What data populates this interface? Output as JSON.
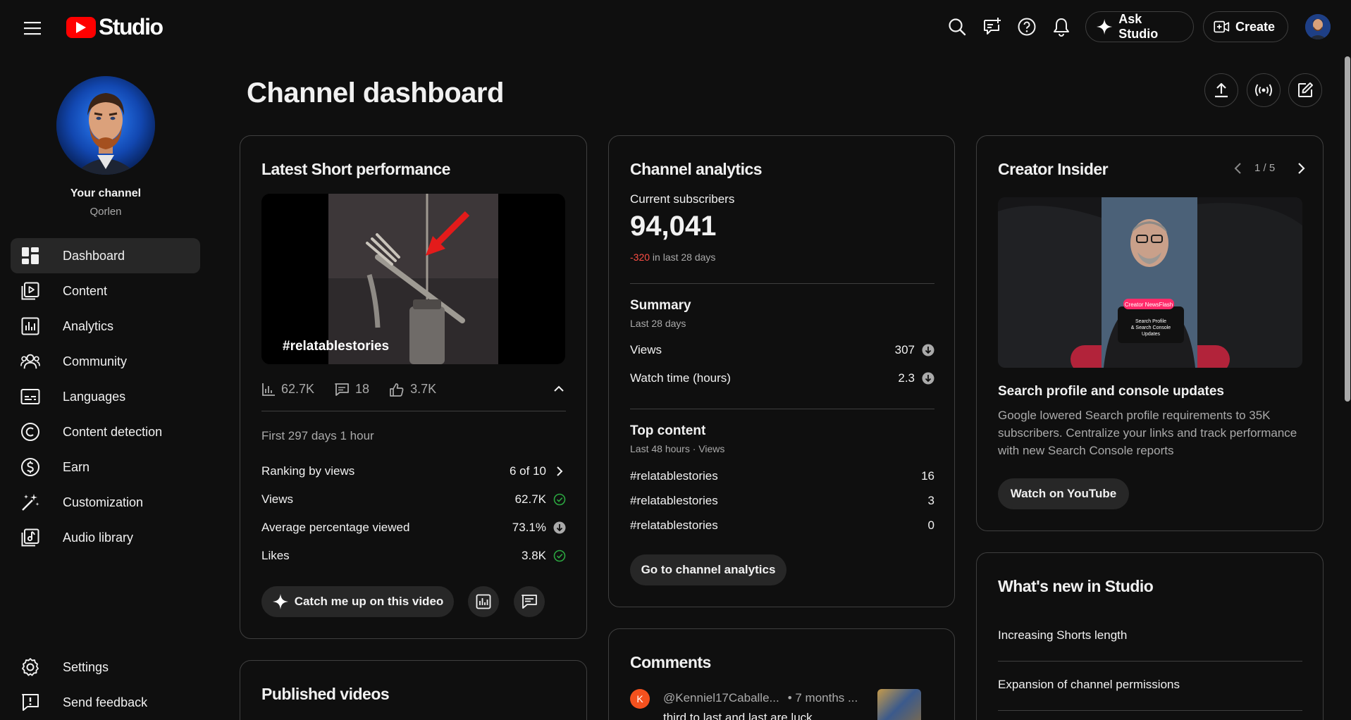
{
  "topbar": {
    "logo_text": "Studio",
    "ask_studio_label": "Ask Studio",
    "create_label": "Create"
  },
  "sidebar": {
    "channel_title": "Your channel",
    "channel_name": "Qorlen",
    "items": [
      {
        "label": "Dashboard",
        "icon": "dashboard-icon",
        "active": true
      },
      {
        "label": "Content",
        "icon": "content-icon"
      },
      {
        "label": "Analytics",
        "icon": "analytics-icon"
      },
      {
        "label": "Community",
        "icon": "community-icon"
      },
      {
        "label": "Languages",
        "icon": "languages-icon"
      },
      {
        "label": "Content detection",
        "icon": "content-detection-icon"
      },
      {
        "label": "Earn",
        "icon": "earn-icon"
      },
      {
        "label": "Customization",
        "icon": "customization-icon"
      },
      {
        "label": "Audio library",
        "icon": "audio-library-icon"
      }
    ],
    "bottom_items": [
      {
        "label": "Settings",
        "icon": "settings-icon"
      },
      {
        "label": "Send feedback",
        "icon": "feedback-icon"
      }
    ]
  },
  "main": {
    "page_title": "Channel dashboard"
  },
  "latest_short": {
    "title": "Latest Short performance",
    "video_title": "#relatablestories",
    "views_short": "62.7K",
    "comments": "18",
    "likes_short": "3.7K",
    "period": "First 297 days 1 hour",
    "metrics": [
      {
        "label": "Ranking by views",
        "value": "6 of 10",
        "indicator": "chevron-right"
      },
      {
        "label": "Views",
        "value": "62.7K",
        "indicator": "check"
      },
      {
        "label": "Average percentage viewed",
        "value": "73.1%",
        "indicator": "down"
      },
      {
        "label": "Likes",
        "value": "3.8K",
        "indicator": "check"
      }
    ],
    "catch_up_label": "Catch me up on this video"
  },
  "published": {
    "title": "Published videos"
  },
  "analytics": {
    "title": "Channel analytics",
    "subs_label": "Current subscribers",
    "subs_value": "94,041",
    "subs_change": "-320",
    "subs_change_suffix": "in last 28 days",
    "summary_title": "Summary",
    "summary_period": "Last 28 days",
    "summary_rows": [
      {
        "label": "Views",
        "value": "307"
      },
      {
        "label": "Watch time (hours)",
        "value": "2.3"
      }
    ],
    "top_title": "Top content",
    "top_period": "Last 48 hours · Views",
    "top_rows": [
      {
        "label": "#relatablestories",
        "value": "16"
      },
      {
        "label": "#relatablestories",
        "value": "3"
      },
      {
        "label": "#relatablestories",
        "value": "0"
      }
    ],
    "go_button": "Go to channel analytics"
  },
  "comments": {
    "title": "Comments",
    "avatar_letter": "K",
    "author": "@Kenniel17Caballe...",
    "time": "• 7 months ...",
    "text": "third to last and last are luck"
  },
  "insider": {
    "title": "Creator Insider",
    "pager": "1 / 5",
    "badge": "Creator NewsFlash",
    "overlay_text": "Search Profile & Search Console Updates",
    "headline": "Search profile and console updates",
    "body": "Google lowered Search profile requirements to 35K subscribers. Centralize your links and track performance with new Search Console reports",
    "watch_label": "Watch on YouTube"
  },
  "whats_new": {
    "title": "What's new in Studio",
    "items": [
      "Increasing Shorts length",
      "Expansion of channel permissions"
    ]
  },
  "colors": {
    "background": "#0f0f0f",
    "accent_red": "#ff0000",
    "negative": "#ff4e45",
    "positive": "#2ba640"
  }
}
